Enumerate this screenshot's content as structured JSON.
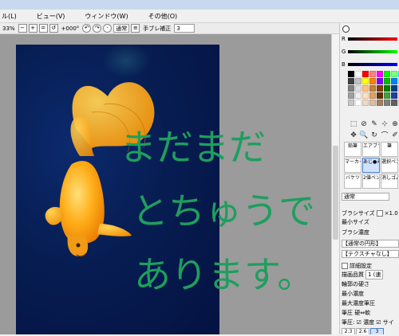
{
  "menu": [
    "ル(L)",
    "ビュー(V)",
    "ウィンドウ(W)",
    "その他(O)"
  ],
  "toolbar": {
    "zoom": "33%",
    "rotation": "+000°",
    "blend_mode": "通常",
    "stabilizer_label": "手ブレ補正",
    "stabilizer_value": "3"
  },
  "canvas": {
    "handwriting_lines": [
      "まだまだ",
      "とちゅうで",
      "あります。"
    ],
    "ink_color": "#1f9e5e",
    "background_color": "#061a52"
  },
  "color_panel": {
    "channels": [
      "R",
      "G",
      "B"
    ],
    "swatches": [
      "#000000",
      "#ffffff",
      "#ff0000",
      "#ff8080",
      "#ff00ff",
      "#00ff00",
      "#80ff80",
      "#00ffff",
      "#404040",
      "#c0c0c0",
      "#ffff00",
      "#ff8000",
      "#8000ff",
      "#00c000",
      "#0080ff",
      "#80ffff",
      "#808080",
      "#e0e0e0",
      "#ffc080",
      "#c08040",
      "#804000",
      "#008000",
      "#004080",
      "#c0c0ff",
      "#a0a0a0",
      "#f0f0f0",
      "#ffe0c0",
      "#e0a060",
      "#603000",
      "#40a040",
      "#2040a0",
      "#e0e0ff",
      "#c8c8c8",
      "#ffffff",
      "#f0d8c8",
      "#d8c0a8",
      "#a08060",
      "#808080",
      "#606060",
      "#e8e8e8"
    ]
  },
  "tool_panel": {
    "icons": [
      "⬚",
      "⊘",
      "✎",
      "⊹",
      "⊕",
      "✥",
      "🔍",
      "↻",
      "⌒",
      "✐"
    ],
    "brushes": [
      "鉛筆",
      "エアブラシ",
      "筆",
      "マーカー",
      "あじ●み",
      "選択ペン",
      "バケツ",
      "2値ペン",
      "消しゴム"
    ]
  },
  "properties": {
    "blend": "通常",
    "brush_size_label": "ブラシサイズ",
    "brush_size_value": "×1.0",
    "min_size_label": "最小サイズ",
    "density_label": "ブラシ濃度",
    "shape_label": "【通常の円形】",
    "texture_label": "【テクスチャなし】",
    "detail_label": "詳細設定",
    "quality_label": "描画品質",
    "quality_value": "1 (速",
    "edge_label": "輪郭の硬さ",
    "min_density_label": "最小濃度",
    "max_density_label": "最大濃度筆圧",
    "pressure_label": "筆圧 硬⇔軟",
    "pressure_checks": "筆圧: ☑ 濃度 ☑ サイ",
    "size_presets": [
      "2.3",
      "2.6",
      "3"
    ]
  }
}
